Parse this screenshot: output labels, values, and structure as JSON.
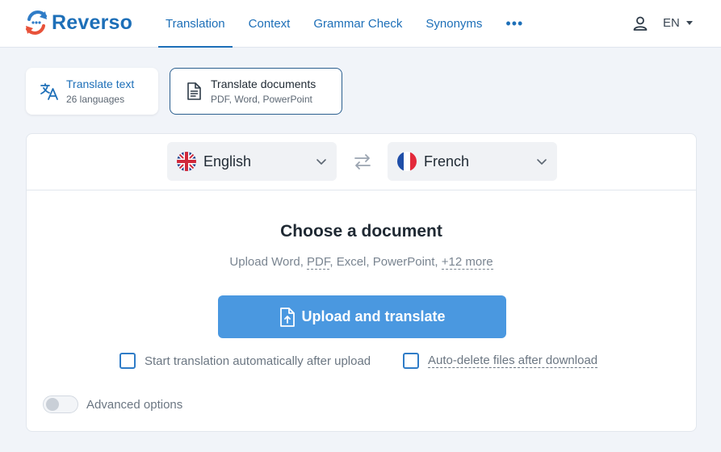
{
  "brand": {
    "name": "Reverso",
    "color": "#1d6fb8"
  },
  "nav": {
    "items": [
      {
        "label": "Translation",
        "active": true
      },
      {
        "label": "Context"
      },
      {
        "label": "Grammar Check"
      },
      {
        "label": "Synonyms"
      }
    ],
    "more": "•••",
    "ui_language": "EN"
  },
  "modes": {
    "text": {
      "title": "Translate text",
      "subtitle": "26 languages",
      "icon": "translate-icon"
    },
    "documents": {
      "title": "Translate documents",
      "subtitle": "PDF, Word, PowerPoint",
      "icon": "document-icon",
      "selected": true
    }
  },
  "languages": {
    "source": {
      "name": "English",
      "flag": "uk-flag-icon"
    },
    "target": {
      "name": "French",
      "flag": "france-flag-icon"
    }
  },
  "upload": {
    "title": "Choose a document",
    "hint_prefix": "Upload Word, ",
    "hint_pdf": "PDF",
    "hint_middle": ", Excel, PowerPoint, ",
    "hint_more": "+12 more",
    "button_label": "Upload and translate",
    "button_color": "#4a98e0"
  },
  "options": {
    "auto_start": {
      "label": "Start translation automatically after upload",
      "checked": false
    },
    "auto_delete": {
      "label": "Auto-delete files after download",
      "checked": false
    },
    "advanced": {
      "label": "Advanced options",
      "enabled": false
    }
  }
}
